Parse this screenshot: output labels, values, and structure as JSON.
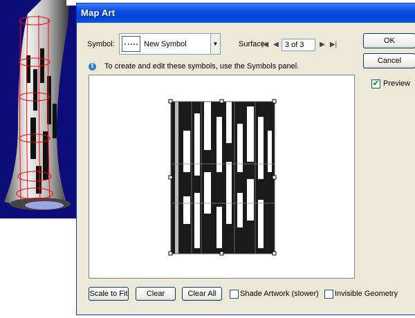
{
  "dialog": {
    "title": "Map Art",
    "symbol_label": "Symbol:",
    "symbol_value": "New Symbol",
    "surface_label": "Surface:",
    "surface_value": "3 of 3",
    "info_text": "To create and edit these symbols, use the Symbols panel.",
    "ok_label": "OK",
    "cancel_label": "Cancel",
    "preview_label": "Preview",
    "preview_checked": true,
    "scale_to_fit_label": "Scale to Fit",
    "clear_label": "Clear",
    "clear_all_label": "Clear All",
    "shade_artwork_label": "Shade Artwork (slower)",
    "shade_artwork_checked": false,
    "invisible_geometry_label": "Invisible Geometry",
    "invisible_geometry_checked": false
  },
  "icons": {
    "info": "info-icon",
    "first": "first-surface-icon",
    "prev": "previous-surface-icon",
    "next": "next-surface-icon",
    "last": "last-surface-icon",
    "dropdown": "chevron-down-icon"
  },
  "colors": {
    "titlebar": "#0a4ce0",
    "dialog_bg": "#ece9d8",
    "background_art": "#0d0d7a",
    "wireframe": "#ff0000",
    "checkmark": "#21a121"
  }
}
